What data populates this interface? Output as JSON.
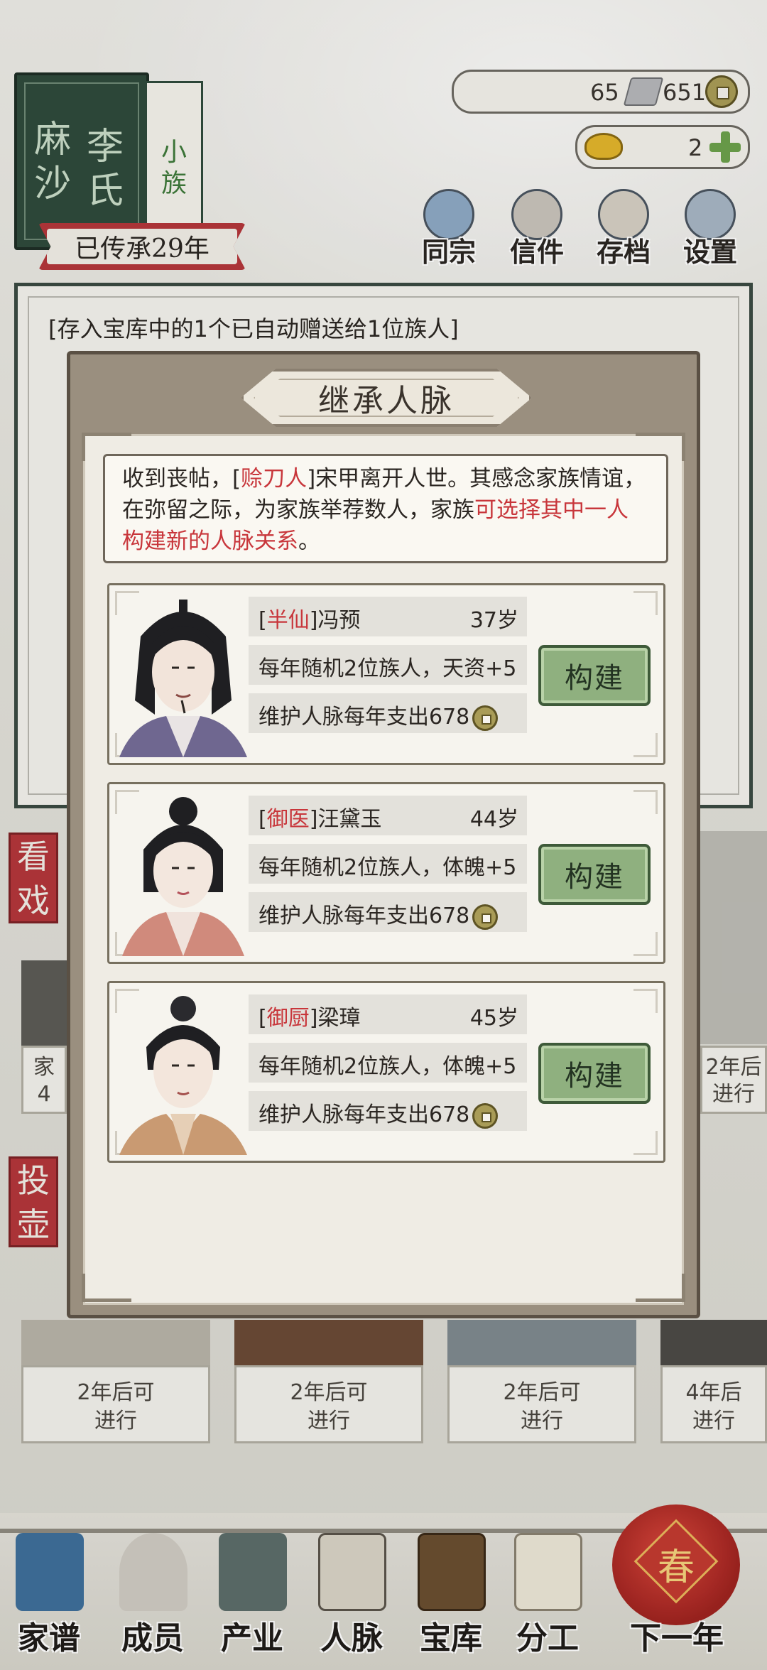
{
  "family": {
    "surname_chars": [
      "麻",
      "沙"
    ],
    "clan_chars": [
      "李",
      "氏"
    ],
    "small_tag_chars": [
      "小",
      "族"
    ],
    "inherit_text": "已传承29年"
  },
  "resources": {
    "silver": "65",
    "coins": "651",
    "gold": "2"
  },
  "top_nav": [
    {
      "label": "同宗",
      "icon": "book-icon"
    },
    {
      "label": "信件",
      "icon": "letter-icon"
    },
    {
      "label": "存档",
      "icon": "brush-icon"
    },
    {
      "label": "设置",
      "icon": "gear-icon"
    }
  ],
  "log": {
    "message": "[存入宝库中的1个已自动赠送给1位族人]"
  },
  "background": {
    "side_tags": [
      "看戏",
      "投壶"
    ],
    "cards": [
      {
        "line1": "家",
        "line2": "4"
      },
      {
        "line1": "2年后",
        "line2": "进行"
      },
      {
        "line1": "2年后可",
        "line2": "进行"
      },
      {
        "line1": "2年后可",
        "line2": "进行"
      },
      {
        "line1": "2年后可",
        "line2": "进行"
      },
      {
        "line1": "4年后",
        "line2": "进行"
      }
    ]
  },
  "bottom_nav": [
    {
      "label": "家谱",
      "icon": "genealogy-icon"
    },
    {
      "label": "成员",
      "icon": "member-icon"
    },
    {
      "label": "产业",
      "icon": "building-icon"
    },
    {
      "label": "人脉",
      "icon": "network-icon"
    },
    {
      "label": "宝库",
      "icon": "treasure-icon"
    },
    {
      "label": "分工",
      "icon": "scroll-icon"
    },
    {
      "label": "下一年",
      "icon": "lantern-icon"
    }
  ],
  "spring_char": "春",
  "modal": {
    "title": "继承人脉",
    "desc": {
      "part1": "收到丧帖，[",
      "role": "赊刀人",
      "part2": "]宋甲离开人世。其感念家族情谊，在弥留之际，为家族举荐数人，家族",
      "highlight": "可选择其中一人构建新的人脉关系",
      "part3": "。"
    },
    "candidates": [
      {
        "title": "半仙",
        "name": "冯预",
        "age": "37岁",
        "bonus": "每年随机2位族人，天资+5",
        "cost": "维护人脉每年支出678",
        "button": "构建"
      },
      {
        "title": "御医",
        "name": "汪黛玉",
        "age": "44岁",
        "bonus": "每年随机2位族人，体魄+5",
        "cost": "维护人脉每年支出678",
        "button": "构建"
      },
      {
        "title": "御厨",
        "name": "梁璋",
        "age": "45岁",
        "bonus": "每年随机2位族人，体魄+5",
        "cost": "维护人脉每年支出678",
        "button": "构建"
      }
    ]
  }
}
